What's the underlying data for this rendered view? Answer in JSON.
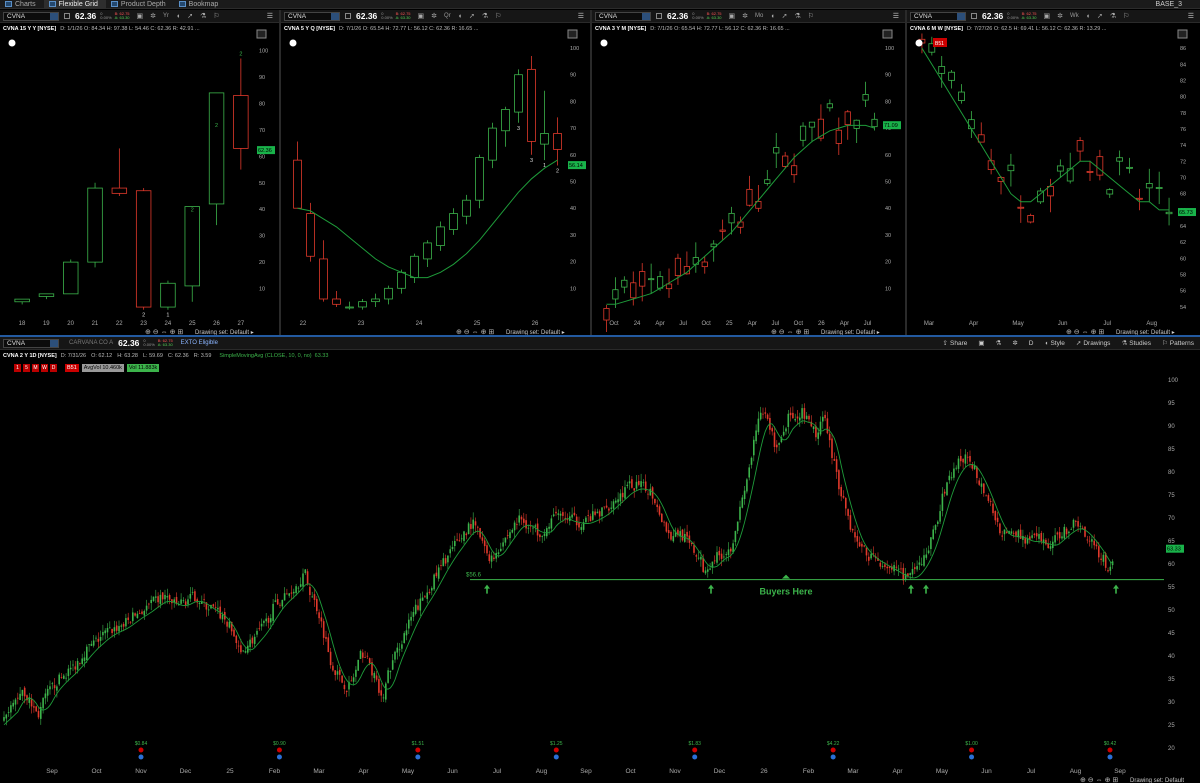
{
  "topbar": {
    "tabs": [
      {
        "label": "Charts",
        "icon": "chart-icon",
        "active": false
      },
      {
        "label": "Flexible Grid",
        "icon": "grid-icon",
        "active": true
      },
      {
        "label": "Product Depth",
        "icon": "depth-icon",
        "active": false
      },
      {
        "label": "Bookmap",
        "icon": "bookmap-icon",
        "active": false
      }
    ],
    "workspace": "BASE_3"
  },
  "common": {
    "symbol": "CVNA",
    "last": "62.36",
    "change": "0",
    "change_pct": "0.00%",
    "bid": "B: 62.75",
    "ask": "A: 63.30",
    "drawing_set": "Drawing set: Default",
    "colors": {
      "up": "#3cb44b",
      "down": "#e0392b",
      "ma": "#1e9c3a",
      "support": "#3cb44b",
      "label_bg": "#19b34a"
    }
  },
  "charts": [
    {
      "id": "c1",
      "aggregation": "Yr",
      "title": "CVNA 15 Y Y [NYSE]",
      "stats": "D: 1/1/26  O: 84.34  H: 97.38  L: 54.46  C: 62.36  R: 42.91 ...",
      "price_label": "62.36",
      "x_ticks": [
        "18",
        "19",
        "20",
        "21",
        "22",
        "23",
        "24",
        "25",
        "26",
        "27"
      ],
      "y_ticks": [
        "100",
        "90",
        "80",
        "70",
        "60",
        "50",
        "40",
        "30",
        "20",
        "10"
      ],
      "y_range": [
        0,
        104
      ],
      "candles": [
        {
          "o": 5,
          "h": 6,
          "l": 4,
          "c": 6
        },
        {
          "o": 7,
          "h": 8,
          "l": 6,
          "c": 8
        },
        {
          "o": 8,
          "h": 21,
          "l": 8,
          "c": 20
        },
        {
          "o": 20,
          "h": 50,
          "l": 18,
          "c": 48
        },
        {
          "o": 48,
          "h": 63,
          "l": 45,
          "c": 46
        },
        {
          "o": 47,
          "h": 48,
          "l": 2,
          "c": 3
        },
        {
          "o": 3,
          "h": 13,
          "l": 2,
          "c": 12
        },
        {
          "o": 11,
          "h": 38,
          "l": 5,
          "c": 41
        },
        {
          "o": 42,
          "h": 70,
          "l": 34,
          "c": 84
        },
        {
          "o": 83,
          "h": 97,
          "l": 55,
          "c": 63
        }
      ],
      "labels": [
        {
          "i": 8,
          "t": "2",
          "pos": "high"
        },
        {
          "i": 9,
          "t": "2",
          "pos": "high"
        },
        {
          "i": 5,
          "t": "2",
          "pos": "low"
        },
        {
          "i": 6,
          "t": "1",
          "pos": "low"
        },
        {
          "i": 7,
          "t": "2",
          "pos": "high"
        }
      ]
    },
    {
      "id": "c2",
      "aggregation": "Qr",
      "title": "CVNA 5 Y Q [NYSE]",
      "stats": "D: 7/1/26  O: 65.54  H: 72.77  L: 56.12  C: 62.36  R: 16.65 ...",
      "price_label": "56.14",
      "x_ticks": [
        "22",
        "23",
        "24",
        "25",
        "26"
      ],
      "y_ticks": [
        "100",
        "90",
        "80",
        "70",
        "60",
        "50",
        "40",
        "30",
        "20",
        "10"
      ],
      "y_range": [
        0,
        103
      ],
      "candles": [
        {
          "o": 58,
          "h": 65,
          "l": 45,
          "c": 40
        },
        {
          "o": 38,
          "h": 42,
          "l": 20,
          "c": 22
        },
        {
          "o": 21,
          "h": 28,
          "l": 5,
          "c": 6
        },
        {
          "o": 6,
          "h": 9,
          "l": 3,
          "c": 4
        },
        {
          "o": 3,
          "h": 5,
          "l": 2,
          "c": 3
        },
        {
          "o": 3,
          "h": 6,
          "l": 2,
          "c": 5
        },
        {
          "o": 5,
          "h": 8,
          "l": 3,
          "c": 6
        },
        {
          "o": 6,
          "h": 11,
          "l": 4,
          "c": 10
        },
        {
          "o": 10,
          "h": 17,
          "l": 8,
          "c": 16
        },
        {
          "o": 14,
          "h": 23,
          "l": 12,
          "c": 22
        },
        {
          "o": 21,
          "h": 28,
          "l": 18,
          "c": 27
        },
        {
          "o": 26,
          "h": 35,
          "l": 24,
          "c": 33
        },
        {
          "o": 32,
          "h": 40,
          "l": 30,
          "c": 38
        },
        {
          "o": 37,
          "h": 45,
          "l": 34,
          "c": 43
        },
        {
          "o": 43,
          "h": 60,
          "l": 40,
          "c": 59
        },
        {
          "o": 58,
          "h": 72,
          "l": 55,
          "c": 70
        },
        {
          "o": 69,
          "h": 78,
          "l": 63,
          "c": 77
        },
        {
          "o": 76,
          "h": 92,
          "l": 72,
          "c": 90
        },
        {
          "o": 92,
          "h": 97,
          "l": 60,
          "c": 65
        },
        {
          "o": 64,
          "h": 84,
          "l": 58,
          "c": 68
        },
        {
          "o": 68,
          "h": 74,
          "l": 56,
          "c": 62
        }
      ],
      "ma": [
        40,
        39,
        36,
        33,
        29,
        25,
        21,
        18,
        16,
        14,
        14,
        16,
        19,
        23,
        28,
        34,
        40,
        46,
        51,
        55,
        58
      ],
      "labels": [
        {
          "i": 17,
          "t": "3",
          "pos": "low"
        },
        {
          "i": 18,
          "t": "3",
          "pos": "low"
        },
        {
          "i": 19,
          "t": "1",
          "pos": "low"
        },
        {
          "i": 20,
          "t": "2",
          "pos": "low"
        }
      ]
    },
    {
      "id": "c3",
      "aggregation": "Mo",
      "title": "CVNA 3 Y M [NYSE]",
      "stats": "D: 7/1/26  O: 65.54  H: 72.77  L: 56.12  C: 62.36  R: 16.65 ...",
      "price_label": "71.09",
      "x_ticks": [
        "Oct",
        "24",
        "Apr",
        "Jul",
        "Oct",
        "25",
        "Apr",
        "Jul",
        "Oct",
        "26",
        "Apr",
        "Jul"
      ],
      "y_ticks": [
        "100",
        "90",
        "80",
        "70",
        "60",
        "50",
        "40",
        "30",
        "20",
        "10"
      ],
      "y_range": [
        0,
        103
      ],
      "ma": [
        4,
        4,
        5,
        6,
        7,
        8,
        10,
        12,
        14,
        16,
        19,
        22,
        25,
        28,
        31,
        35,
        39,
        43,
        47,
        51,
        55,
        59,
        62,
        65,
        67,
        69,
        70,
        71,
        71,
        71,
        70
      ]
    },
    {
      "id": "c4",
      "aggregation": "Wk",
      "title": "CVNA 6 M W [NYSE]",
      "stats": "D: 7/27/26  O: 62.5  H: 69.41  L: 56.12  C: 62.36  R: 13.29 ...",
      "price_label": "65.73",
      "earnings_badge": "B51",
      "x_ticks": [
        "Mar",
        "Apr",
        "May",
        "Jun",
        "Jul",
        "Aug"
      ],
      "y_ticks": [
        "86",
        "84",
        "82",
        "80",
        "78",
        "76",
        "74",
        "72",
        "70",
        "68",
        "66",
        "64",
        "62",
        "60",
        "58",
        "56",
        "54"
      ],
      "y_range": [
        53,
        87
      ],
      "ma": [
        86,
        84,
        82,
        80,
        78,
        76,
        74,
        72,
        70,
        68,
        67,
        67,
        68,
        69,
        70,
        71,
        72,
        72,
        71,
        70,
        69,
        68,
        67,
        67,
        66,
        66
      ]
    }
  ],
  "main": {
    "aggregation": "D",
    "company": "CARVANA CO A",
    "etrade": "EXTO Eligible",
    "title": "CVNA 2 Y 1D [NYSE]",
    "stats": [
      "D: 7/31/26",
      "O: 62.12",
      "H: 63.28",
      "L: 59.69",
      "C: 62.36",
      "R: 3.59"
    ],
    "study": "SimpleMovingAvg (CLOSE, 10, 0, no)",
    "study_value": "63.33",
    "tf_buttons": [
      "1",
      "5",
      "M",
      "W",
      "D"
    ],
    "volume": {
      "badge": "B51",
      "avg": "AvgVol 10.460k",
      "vol": "Vol 11.883k"
    },
    "tools": [
      "Share",
      "",
      "",
      "",
      "D",
      "Style",
      "Drawings",
      "Studies",
      "Patterns"
    ],
    "price_label": "63.33",
    "support": {
      "value": 56.6,
      "label": "$56.6",
      "annotation": "Buyers Here"
    },
    "x_ticks": [
      "Sep",
      "Oct",
      "Nov",
      "Dec",
      "25",
      "Feb",
      "Mar",
      "Apr",
      "May",
      "Jun",
      "Jul",
      "Aug",
      "Sep",
      "Oct",
      "Nov",
      "Dec",
      "26",
      "Feb",
      "Mar",
      "Apr",
      "May",
      "Jun",
      "Jul",
      "Aug",
      "Sep"
    ],
    "y_ticks": [
      "100",
      "95",
      "90",
      "85",
      "80",
      "75",
      "70",
      "65",
      "60",
      "55",
      "50",
      "45",
      "40",
      "35",
      "30",
      "25",
      "20"
    ],
    "y_range": [
      18,
      102
    ],
    "dividends": [
      "$0.84",
      "$0.90",
      "$1.51",
      "$1.25",
      "$1.83",
      "$4.22",
      "$1.00",
      "$0.42"
    ],
    "path": [
      [
        0,
        24
      ],
      [
        10,
        28
      ],
      [
        22,
        33
      ],
      [
        30,
        30
      ],
      [
        38,
        27
      ],
      [
        45,
        31
      ],
      [
        55,
        34
      ],
      [
        65,
        36
      ],
      [
        75,
        38
      ],
      [
        85,
        41
      ],
      [
        95,
        43
      ],
      [
        105,
        45
      ],
      [
        115,
        46
      ],
      [
        125,
        47
      ],
      [
        135,
        49
      ],
      [
        145,
        50
      ],
      [
        155,
        52
      ],
      [
        165,
        53
      ],
      [
        175,
        51
      ],
      [
        185,
        52
      ],
      [
        195,
        53
      ],
      [
        205,
        51
      ],
      [
        215,
        50
      ],
      [
        225,
        48
      ],
      [
        235,
        44
      ],
      [
        240,
        40
      ],
      [
        245,
        42
      ],
      [
        255,
        44
      ],
      [
        265,
        47
      ],
      [
        275,
        51
      ],
      [
        285,
        53
      ],
      [
        295,
        55
      ],
      [
        305,
        58
      ],
      [
        310,
        54
      ],
      [
        318,
        50
      ],
      [
        325,
        44
      ],
      [
        332,
        38
      ],
      [
        340,
        35
      ],
      [
        348,
        33
      ],
      [
        355,
        36
      ],
      [
        362,
        41
      ],
      [
        370,
        38
      ],
      [
        378,
        33
      ],
      [
        382,
        30
      ],
      [
        388,
        36
      ],
      [
        395,
        40
      ],
      [
        405,
        45
      ],
      [
        415,
        50
      ],
      [
        425,
        53
      ],
      [
        435,
        57
      ],
      [
        445,
        61
      ],
      [
        455,
        64
      ],
      [
        465,
        67
      ],
      [
        472,
        69
      ],
      [
        478,
        67
      ],
      [
        485,
        63
      ],
      [
        492,
        61
      ],
      [
        500,
        64
      ],
      [
        510,
        67
      ],
      [
        520,
        70
      ],
      [
        530,
        68
      ],
      [
        540,
        67
      ],
      [
        550,
        68
      ],
      [
        556,
        72
      ],
      [
        560,
        70
      ],
      [
        570,
        70
      ],
      [
        580,
        69
      ],
      [
        590,
        70
      ],
      [
        600,
        71
      ],
      [
        610,
        73
      ],
      [
        620,
        75
      ],
      [
        630,
        77
      ],
      [
        640,
        77
      ],
      [
        650,
        76
      ],
      [
        655,
        74
      ],
      [
        660,
        71
      ],
      [
        670,
        66
      ],
      [
        680,
        67
      ],
      [
        690,
        64
      ],
      [
        700,
        61
      ],
      [
        705,
        58
      ],
      [
        712,
        61
      ],
      [
        720,
        62
      ],
      [
        730,
        63
      ],
      [
        738,
        70
      ],
      [
        745,
        76
      ],
      [
        752,
        84
      ],
      [
        758,
        91
      ],
      [
        764,
        93
      ],
      [
        770,
        90
      ],
      [
        776,
        85
      ],
      [
        782,
        88
      ],
      [
        790,
        93
      ],
      [
        796,
        90
      ],
      [
        802,
        93
      ],
      [
        810,
        90
      ],
      [
        818,
        88
      ],
      [
        825,
        93
      ],
      [
        830,
        86
      ],
      [
        838,
        78
      ],
      [
        845,
        73
      ],
      [
        852,
        67
      ],
      [
        860,
        64
      ],
      [
        868,
        62
      ],
      [
        876,
        61
      ],
      [
        884,
        60
      ],
      [
        892,
        59
      ],
      [
        900,
        58
      ],
      [
        908,
        57
      ],
      [
        914,
        58
      ],
      [
        920,
        60
      ],
      [
        928,
        63
      ],
      [
        935,
        68
      ],
      [
        942,
        74
      ],
      [
        950,
        79
      ],
      [
        958,
        82
      ],
      [
        966,
        83
      ],
      [
        974,
        81
      ],
      [
        982,
        77
      ],
      [
        990,
        73
      ],
      [
        998,
        68
      ],
      [
        1006,
        66
      ],
      [
        1014,
        67
      ],
      [
        1022,
        66
      ],
      [
        1030,
        65
      ],
      [
        1038,
        66
      ],
      [
        1046,
        64
      ],
      [
        1054,
        65
      ],
      [
        1062,
        67
      ],
      [
        1070,
        68
      ],
      [
        1078,
        69
      ],
      [
        1086,
        66
      ],
      [
        1094,
        65
      ],
      [
        1100,
        62
      ],
      [
        1106,
        60
      ],
      [
        1110,
        59
      ],
      [
        1114,
        62
      ]
    ],
    "arrows_x": [
      487,
      711,
      911,
      926,
      1116
    ]
  }
}
